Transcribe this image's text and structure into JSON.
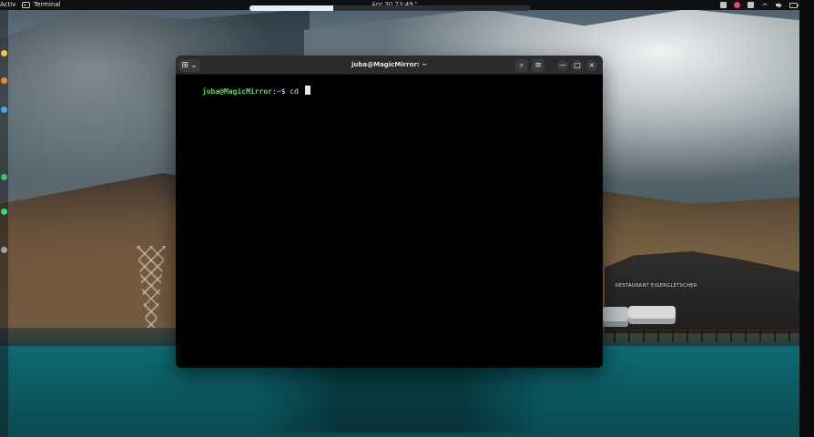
{
  "topbar": {
    "activities_label": "Activities",
    "app_label": "Terminal",
    "datetime": "Apr 30  23:49",
    "caret_glyph": "⌃"
  },
  "progress_overlay": {
    "percent": 30
  },
  "wallpaper": {
    "building_sign": "RESTAURANT EIGERGLETSCHER"
  },
  "dock": {
    "items": [
      {
        "color": "#f5c542"
      },
      {
        "color": "#f08a2a"
      },
      {
        "color": "#4aa3ff"
      },
      {
        "color": "#3cc46a"
      },
      {
        "color": "#2fdc6f"
      },
      {
        "color": "#9aa3ad"
      }
    ]
  },
  "terminal": {
    "title": "juba@MagicMirror: ~",
    "header": {
      "left_button_glyph": "⊞",
      "left_dropdown_glyph": "⌄",
      "search_glyph": "⌕",
      "menu_glyph": "≡",
      "minimize_glyph": "—",
      "maximize_glyph": "□",
      "close_glyph": "×"
    },
    "prompt": {
      "user_host": "juba@MagicMirror",
      "path": "~",
      "symbol": "$",
      "command": "cd"
    }
  }
}
